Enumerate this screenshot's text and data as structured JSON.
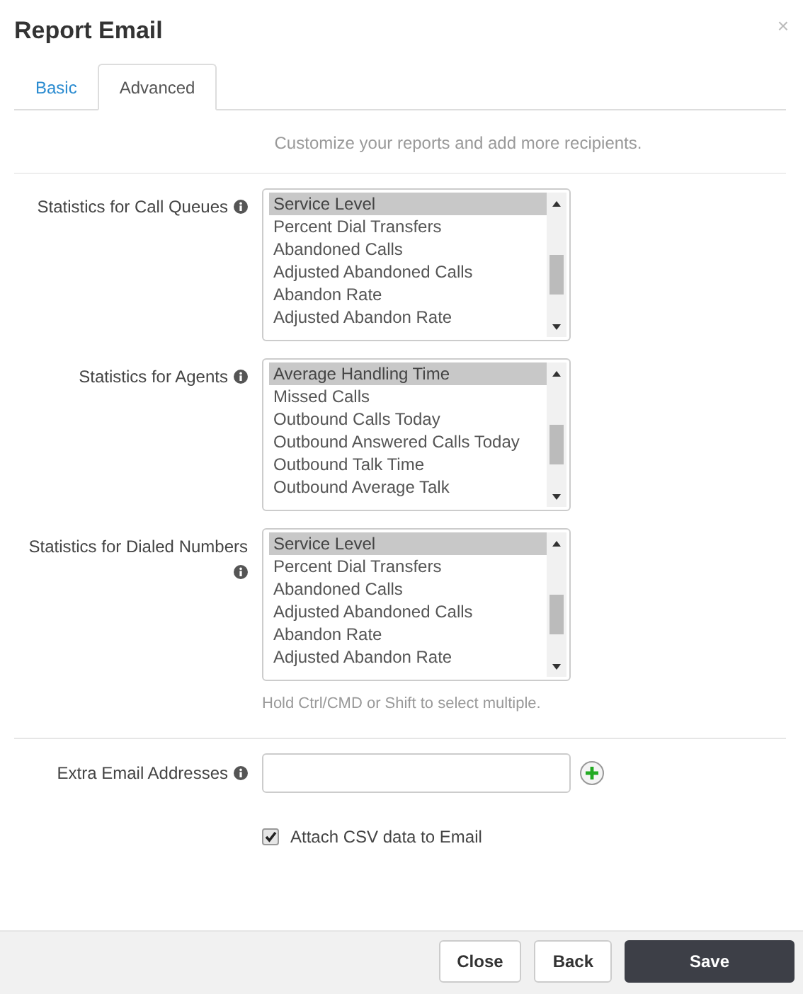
{
  "dialog": {
    "title": "Report Email",
    "close": "×"
  },
  "tabs": [
    {
      "label": "Basic",
      "selected": false
    },
    {
      "label": "Advanced",
      "selected": true
    }
  ],
  "intro": "Customize your reports and add more recipients.",
  "statistics": [
    {
      "label": "Statistics for Call Queues",
      "options": [
        {
          "label": "Service Level",
          "selected": true
        },
        {
          "label": "Percent Dial Transfers",
          "selected": false
        },
        {
          "label": "Abandoned Calls",
          "selected": false
        },
        {
          "label": "Adjusted Abandoned Calls",
          "selected": false
        },
        {
          "label": "Abandon Rate",
          "selected": false
        },
        {
          "label": "Adjusted Abandon Rate",
          "selected": false
        }
      ]
    },
    {
      "label": "Statistics for Agents",
      "options": [
        {
          "label": "Average Handling Time",
          "selected": true
        },
        {
          "label": "Missed Calls",
          "selected": false
        },
        {
          "label": "Outbound Calls Today",
          "selected": false
        },
        {
          "label": "Outbound Answered Calls Today",
          "selected": false
        },
        {
          "label": "Outbound Talk Time",
          "selected": false
        },
        {
          "label": "Outbound Average Talk",
          "selected": false
        }
      ]
    },
    {
      "label": "Statistics for Dialed Numbers",
      "options": [
        {
          "label": "Service Level",
          "selected": true
        },
        {
          "label": "Percent Dial Transfers",
          "selected": false
        },
        {
          "label": "Abandoned Calls",
          "selected": false
        },
        {
          "label": "Adjusted Abandoned Calls",
          "selected": false
        },
        {
          "label": "Abandon Rate",
          "selected": false
        },
        {
          "label": "Adjusted Abandon Rate",
          "selected": false
        }
      ]
    }
  ],
  "hint": "Hold Ctrl/CMD or Shift to select multiple.",
  "extra_emails": {
    "label": "Extra Email Addresses"
  },
  "attach_csv": {
    "label": "Attach CSV data to Email",
    "checked": true
  },
  "buttons": [
    {
      "label": "Close",
      "kind": "default"
    },
    {
      "label": "Back",
      "kind": "default"
    },
    {
      "label": "Save",
      "kind": "primary"
    }
  ]
}
